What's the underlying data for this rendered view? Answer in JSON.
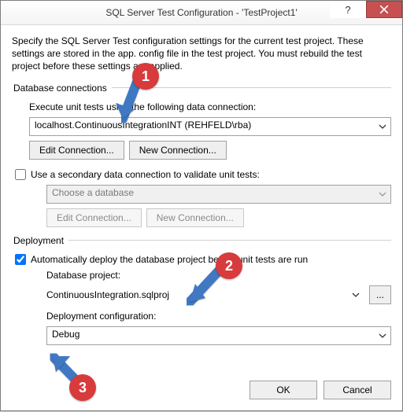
{
  "titlebar": {
    "title": "SQL Server Test Configuration - 'TestProject1'"
  },
  "intro": "Specify the SQL Server Test configuration settings for the current test project. These settings are stored in the app. config file in the test project. You must rebuild the test project before these settings are applied.",
  "dbconn": {
    "legend": "Database connections",
    "primary_label": "Execute unit tests using the following data connection:",
    "primary_value": "localhost.ContinuousIntegrationINT (REHFELD\\rba)",
    "edit_btn": "Edit Connection...",
    "new_btn": "New Connection...",
    "secondary_check_label": "Use a secondary data connection to validate unit tests:",
    "secondary_placeholder": "Choose a database",
    "sec_edit_btn": "Edit Connection...",
    "sec_new_btn": "New Connection..."
  },
  "deploy": {
    "legend": "Deployment",
    "auto_label": "Automatically deploy the database project before unit tests are run",
    "project_label": "Database project:",
    "project_value": "ContinuousIntegration.sqlproj",
    "browse_btn": "...",
    "config_label": "Deployment configuration:",
    "config_value": "Debug"
  },
  "dlg": {
    "ok": "OK",
    "cancel": "Cancel"
  },
  "anno": {
    "a1": "1",
    "a2": "2",
    "a3": "3"
  }
}
